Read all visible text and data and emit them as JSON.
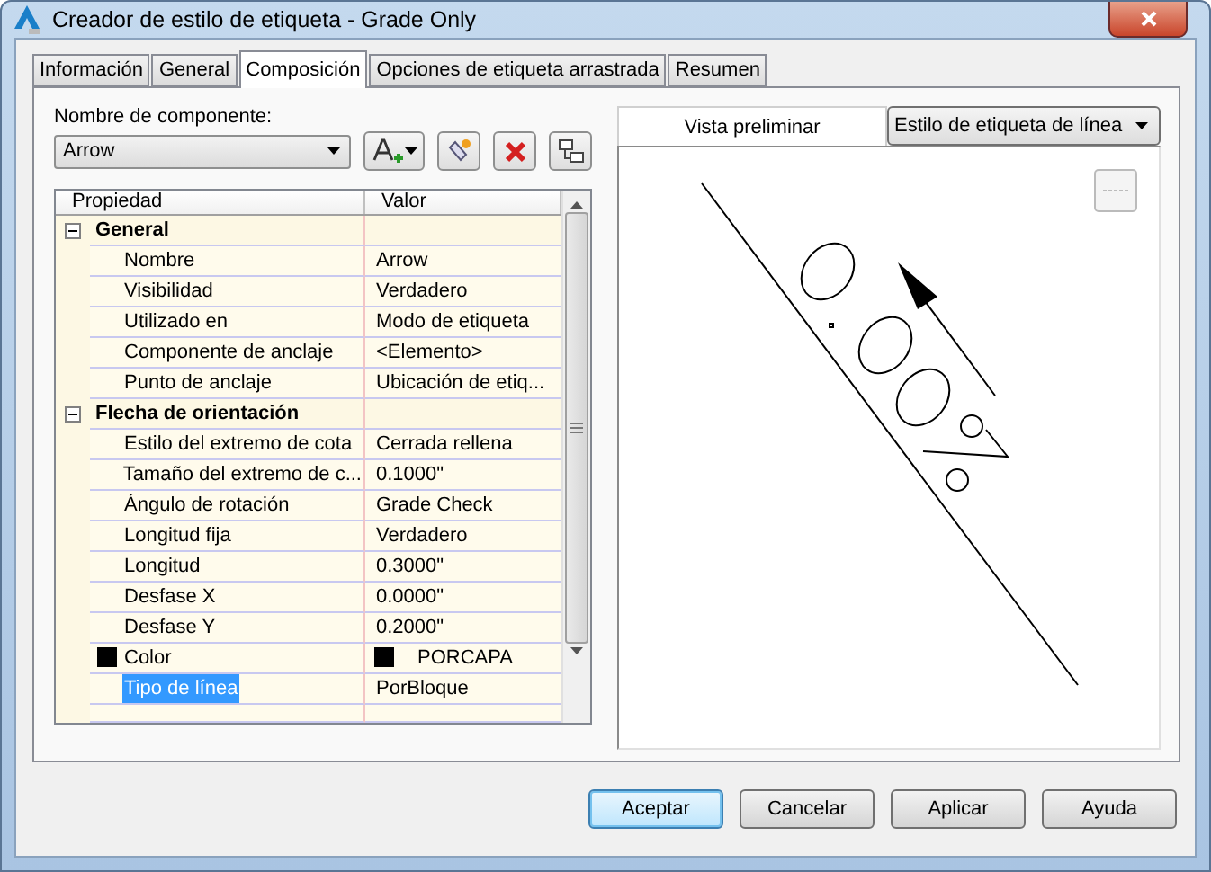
{
  "window": {
    "title": "Creador de estilo de etiqueta - Grade Only"
  },
  "tabs": [
    {
      "label": "Información",
      "selected": false
    },
    {
      "label": "General",
      "selected": false
    },
    {
      "label": "Composición",
      "selected": true
    },
    {
      "label": "Opciones de etiqueta arrastrada",
      "selected": false
    },
    {
      "label": "Resumen",
      "selected": false
    }
  ],
  "component": {
    "label": "Nombre de componente:",
    "value": "Arrow"
  },
  "property_grid": {
    "columns": [
      "Propiedad",
      "Valor"
    ],
    "groups": [
      {
        "name": "General",
        "expanded": true,
        "rows": [
          {
            "kind": "text",
            "name": "Nombre",
            "value": "Arrow",
            "selected": false
          },
          {
            "kind": "text",
            "name": "Visibilidad",
            "value": "Verdadero",
            "selected": false
          },
          {
            "kind": "text",
            "name": "Utilizado en",
            "value": "Modo de etiqueta",
            "selected": false
          },
          {
            "kind": "text",
            "name": "Componente de anclaje",
            "value": "<Elemento>",
            "selected": false
          },
          {
            "kind": "text",
            "name": "Punto de anclaje",
            "value": "Ubicación de etiq...",
            "selected": false
          }
        ]
      },
      {
        "name": "Flecha de orientación",
        "expanded": true,
        "rows": [
          {
            "kind": "text",
            "name": "Estilo del extremo de cota",
            "value": "Cerrada rellena",
            "selected": false
          },
          {
            "kind": "text",
            "name": "Tamaño del extremo de c...",
            "value": "0.1000\"",
            "selected": false
          },
          {
            "kind": "text",
            "name": "Ángulo de rotación",
            "value": "Grade Check",
            "selected": false
          },
          {
            "kind": "text",
            "name": "Longitud fija",
            "value": "Verdadero",
            "selected": false
          },
          {
            "kind": "text",
            "name": "Longitud",
            "value": "0.3000\"",
            "selected": false
          },
          {
            "kind": "text",
            "name": "Desfase X",
            "value": "0.0000\"",
            "selected": false
          },
          {
            "kind": "text",
            "name": "Desfase Y",
            "value": "0.2000\"",
            "selected": false
          },
          {
            "kind": "color",
            "name": "Color",
            "value": "PORCAPA",
            "selected": false
          },
          {
            "kind": "text",
            "name": "Tipo de línea",
            "value": "PorBloque",
            "selected": true
          }
        ]
      }
    ]
  },
  "preview": {
    "label": "Vista preliminar",
    "style": "Estilo de etiqueta de línea"
  },
  "buttons": [
    {
      "label": "Aceptar",
      "default": true
    },
    {
      "label": "Cancelar",
      "default": false
    },
    {
      "label": "Aplicar",
      "default": false
    },
    {
      "label": "Ayuda",
      "default": false
    }
  ]
}
